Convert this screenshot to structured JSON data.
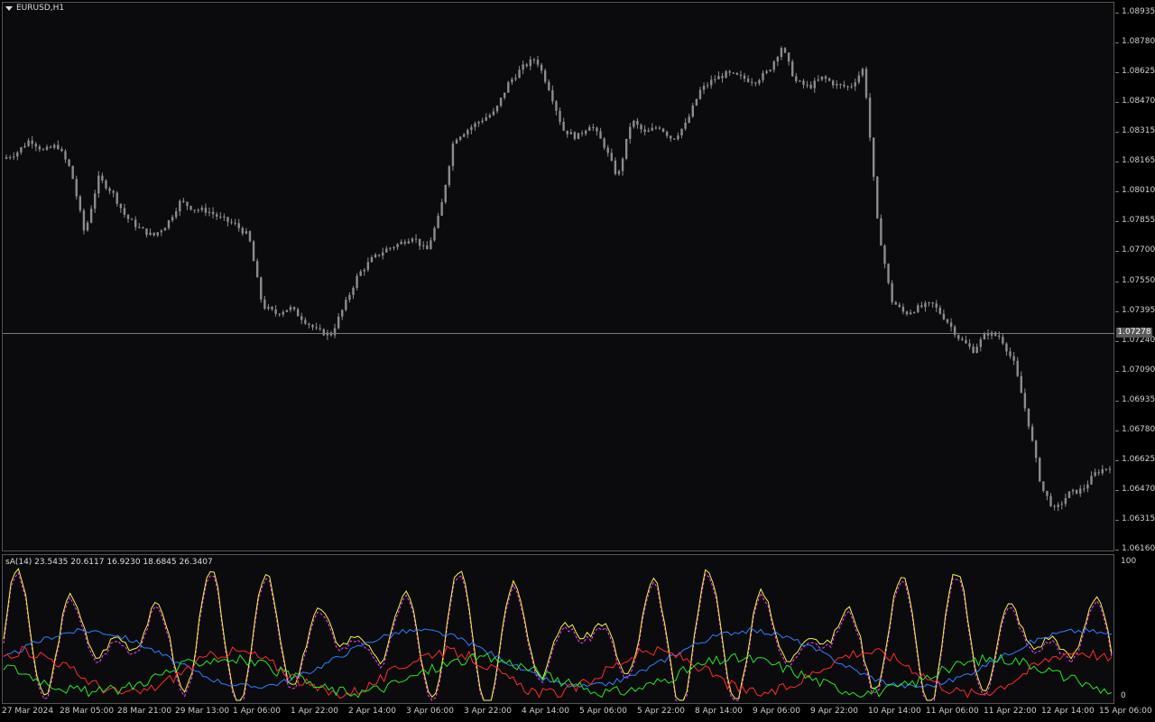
{
  "chart": {
    "symbol": "EURUSD,H1",
    "price_labels": [
      "1.08935",
      "1.08780",
      "1.08625",
      "1.08470",
      "1.08315",
      "1.08165",
      "1.08010",
      "1.07855",
      "1.07700",
      "1.07550",
      "1.07395",
      "1.07240",
      "1.07090",
      "1.06935",
      "1.06780",
      "1.06625",
      "1.06470",
      "1.06315",
      "1.06160"
    ],
    "current_price": "1.07278",
    "time_labels": [
      "27 Mar 2024",
      "28 Mar 05:00",
      "28 Mar 21:00",
      "29 Mar 13:00",
      "1 Apr 06:00",
      "1 Apr 22:00",
      "2 Apr 14:00",
      "3 Apr 06:00",
      "3 Apr 22:00",
      "4 Apr 14:00",
      "5 Apr 06:00",
      "5 Apr 22:00",
      "8 Apr 14:00",
      "9 Apr 06:00",
      "9 Apr 22:00",
      "10 Apr 14:00",
      "11 Apr 06:00",
      "11 Apr 22:00",
      "12 Apr 14:00",
      "15 Apr 06:00"
    ],
    "colors": {
      "background": "#0b0b0e",
      "candle": "#8c8c8c",
      "grid_line": "#7a7a7a"
    }
  },
  "indicator": {
    "title": "sA(14) 23.5435 20.6117 16.9230 18.6845 26.3407",
    "axis_labels": [
      "100",
      "0"
    ],
    "colors": {
      "yellow": "#f4f542",
      "magenta": "#ff40ff",
      "blue": "#2f7fff",
      "red": "#ff2a2a",
      "green": "#27e627"
    }
  },
  "chart_data": {
    "type": "line",
    "title": "",
    "xlabel": "",
    "ylabel": "",
    "ylim": [
      1.0616,
      1.08935
    ],
    "close_path": [
      1.0818,
      1.0821,
      1.0828,
      1.0822,
      1.0825,
      1.0812,
      1.0779,
      1.0808,
      1.0801,
      1.0788,
      1.0782,
      1.0778,
      1.0784,
      1.0796,
      1.0792,
      1.0791,
      1.0787,
      1.0784,
      1.0778,
      1.0742,
      1.0738,
      1.0741,
      1.0735,
      1.0729,
      1.0727,
      1.0742,
      1.0758,
      1.0766,
      1.0771,
      1.0774,
      1.0778,
      1.077,
      1.079,
      1.0828,
      1.0833,
      1.0838,
      1.0842,
      1.0857,
      1.0865,
      1.087,
      1.0854,
      1.0833,
      1.0829,
      1.0836,
      1.0825,
      1.0808,
      1.0838,
      1.0831,
      1.0835,
      1.0828,
      1.0836,
      1.0853,
      1.0859,
      1.0862,
      1.086,
      1.0858,
      1.0863,
      1.0876,
      1.0858,
      1.0855,
      1.086,
      1.0856,
      1.0855,
      1.0865,
      1.0785,
      1.0745,
      1.0738,
      1.0741,
      1.0743,
      1.0735,
      1.0725,
      1.0719,
      1.0728,
      1.0726,
      1.0712,
      1.0683,
      1.0648,
      1.0636,
      1.0645,
      1.0647,
      1.0656,
      1.0659
    ]
  }
}
